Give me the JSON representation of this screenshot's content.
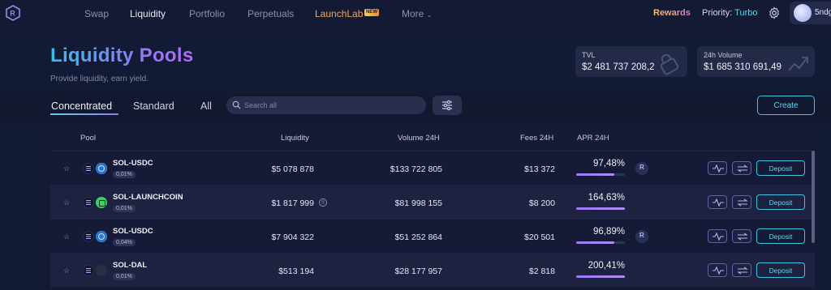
{
  "nav": {
    "items": [
      {
        "label": "Swap"
      },
      {
        "label": "Liquidity"
      },
      {
        "label": "Portfolio"
      },
      {
        "label": "Perpetuals"
      },
      {
        "label": "LaunchLab"
      },
      {
        "label": "More"
      }
    ],
    "new_badge": "NEW",
    "rewards": "Rewards",
    "priority_label": "Priority:",
    "priority_value": "Turbo",
    "wallet_name": "5ndg"
  },
  "header": {
    "title": "Liquidity Pools",
    "subtitle": "Provide liquidity, earn yield."
  },
  "stats": {
    "tvl_label": "TVL",
    "tvl_value": "$2 481 737 208,2",
    "volume_label": "24h Volume",
    "volume_value": "$1 685 310 691,49"
  },
  "tabs": [
    {
      "label": "Concentrated"
    },
    {
      "label": "Standard"
    },
    {
      "label": "All"
    }
  ],
  "search": {
    "placeholder": "Search all"
  },
  "create_label": "Create",
  "table": {
    "headers": {
      "pool": "Pool",
      "liquidity": "Liquidity",
      "volume": "Volume 24H",
      "fees": "Fees 24H",
      "apr": "APR 24H"
    },
    "rows": [
      {
        "pair": "SOL-USDC",
        "fee": "0,01%",
        "liquidity": "$5 078 878",
        "volume": "$133 722 805",
        "fees": "$13 372",
        "apr": "97,48%",
        "apr_fill": 0.78
      },
      {
        "pair": "SOL-LAUNCHCOIN",
        "fee": "0,01%",
        "liquidity": "$1 817 999",
        "volume": "$81 998 155",
        "fees": "$8 200",
        "apr": "164,63%",
        "apr_fill": 1.0
      },
      {
        "pair": "SOL-USDC",
        "fee": "0,04%",
        "liquidity": "$7 904 322",
        "volume": "$51 252 864",
        "fees": "$20 501",
        "apr": "96,89%",
        "apr_fill": 0.78
      },
      {
        "pair": "SOL-DAL",
        "fee": "0,01%",
        "liquidity": "$513 194",
        "volume": "$28 177 957",
        "fees": "$2 818",
        "apr": "200,41%",
        "apr_fill": 1.0
      }
    ],
    "deposit_label": "Deposit"
  }
}
